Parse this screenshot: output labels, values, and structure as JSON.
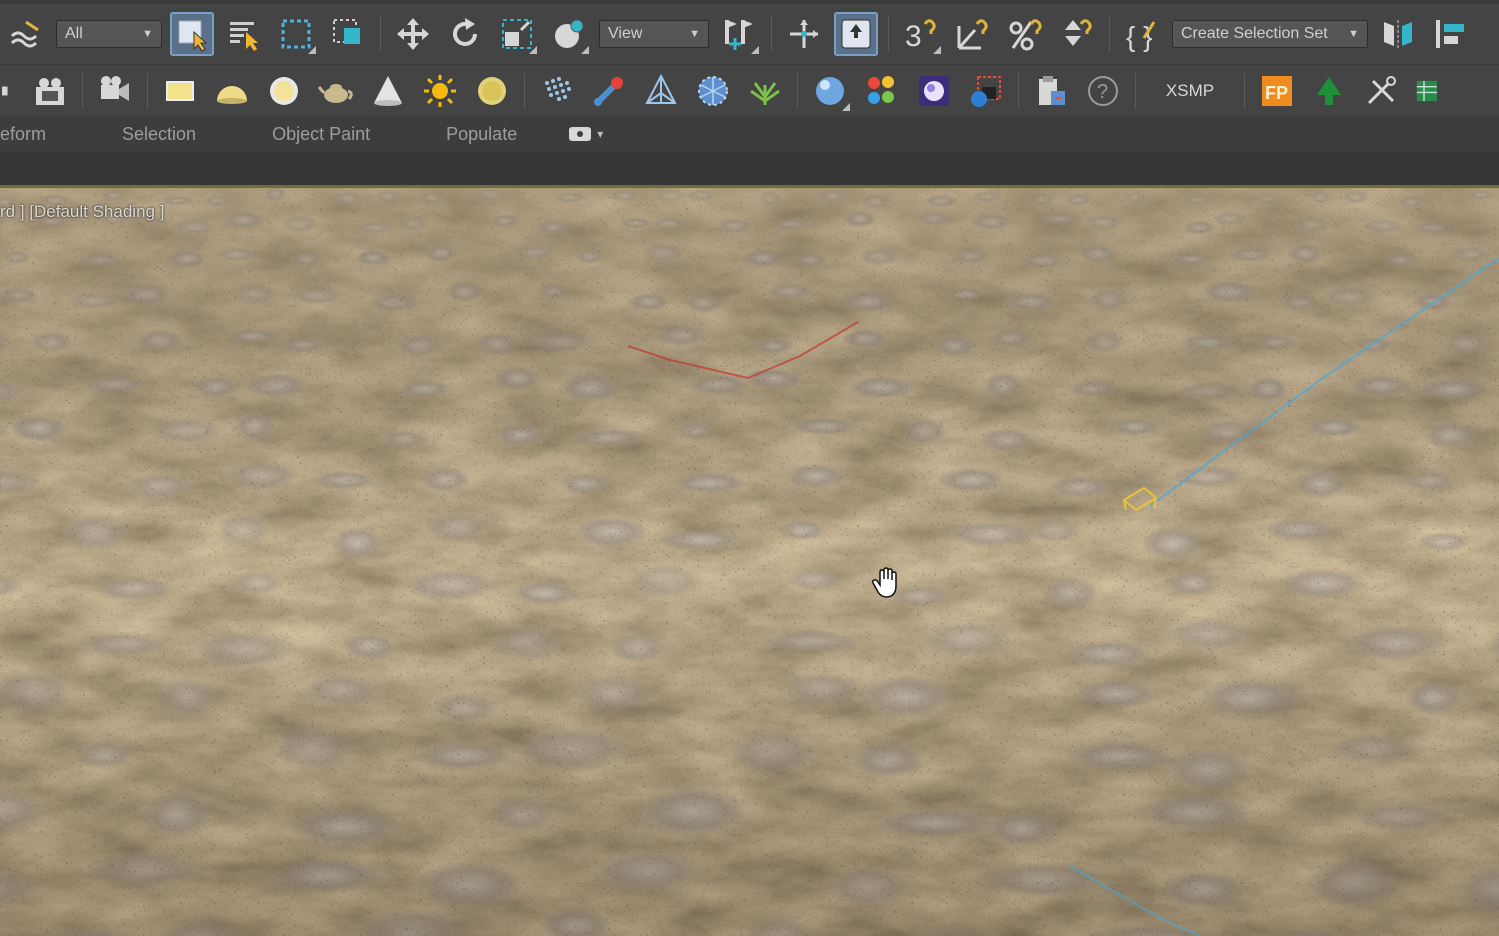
{
  "main_toolbar": {
    "selection_filter": "All",
    "reference_coord": "View",
    "named_selection_set": "Create Selection Set",
    "xsmp_label": "XSMP",
    "fp_label": "FP",
    "snap_label": "3"
  },
  "ribbon": {
    "tabs": [
      "eform",
      "Selection",
      "Object Paint",
      "Populate"
    ]
  },
  "viewport": {
    "label": "rd ] [Default Shading ]"
  },
  "colors": {
    "toolbar_bg": "#444444",
    "active_button": "#5a6f88",
    "ground_base": "#6c5a3d"
  }
}
